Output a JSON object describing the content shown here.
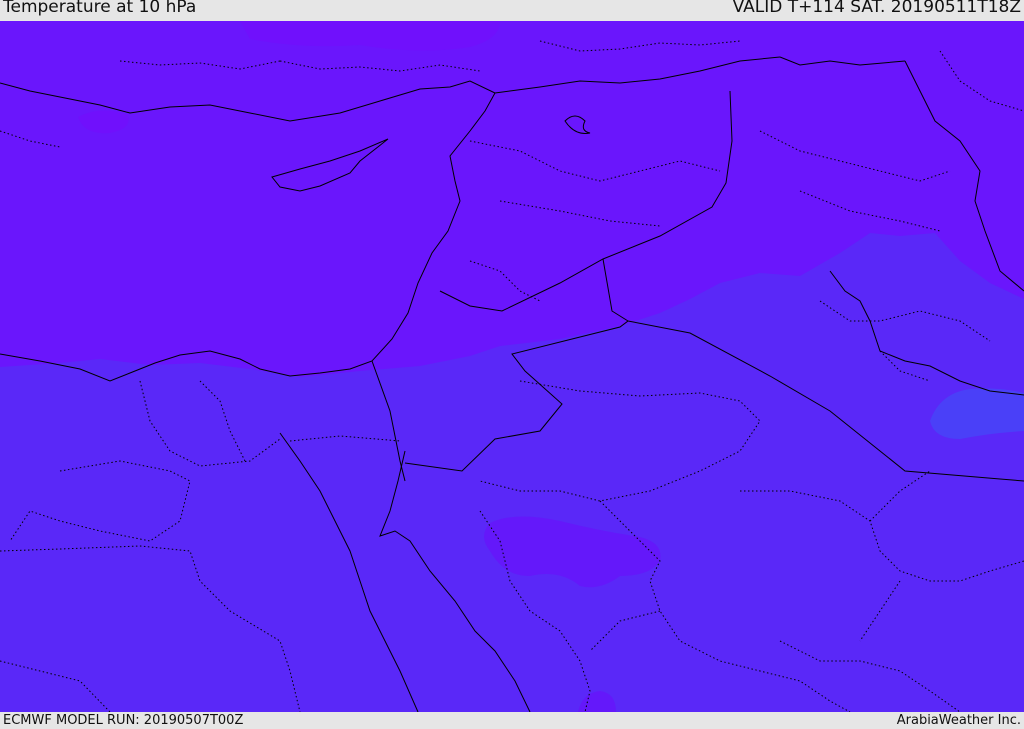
{
  "header": {
    "title": "Temperature at 10 hPa",
    "valid": "VALID T+114 SAT. 20190511T18Z"
  },
  "footer": {
    "model_run": "ECMWF MODEL RUN: 20190507T00Z",
    "credit": "ArabiaWeather Inc."
  },
  "map": {
    "field": "Temperature at 10 hPa",
    "colors": {
      "warm_band": "#6a16fc",
      "cool_band": "#5a28f8",
      "cold_patch": "#4a40f8",
      "warm_patch": "#7010fc",
      "border_line": "#000000"
    }
  }
}
